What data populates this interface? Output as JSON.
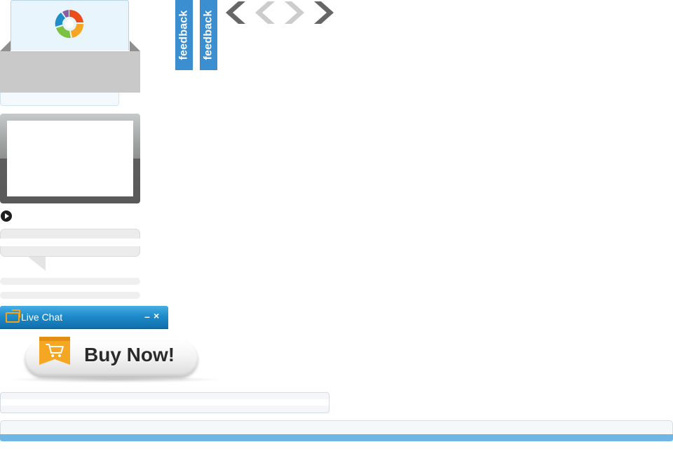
{
  "feedback": {
    "tab1_label": "feedback",
    "tab2_label": "feedback"
  },
  "carousel": {
    "prev_active_color": "#666666",
    "prev_inactive_color": "#cccccc",
    "next_inactive_color": "#cccccc",
    "next_active_color": "#666666"
  },
  "logo": {
    "icon_name": "app-logo-swirl-icon",
    "colors": [
      "#e94e1b",
      "#f5a623",
      "#7cc242",
      "#1e8ec9",
      "#8b5ea3"
    ]
  },
  "video": {
    "play_icon": "play-icon"
  },
  "live_chat": {
    "title": "Live Chat",
    "minimize_label": "–",
    "close_label": "×",
    "icon_name": "popout-icon",
    "accent_color": "#1f8bcb"
  },
  "buy_now": {
    "label": "Buy Now!",
    "icon_name": "shopping-cart-icon",
    "ribbon_color": "#f5a623"
  },
  "theme": {
    "primary_blue": "#3b8fd0",
    "light_blue": "#6fb6e4"
  }
}
